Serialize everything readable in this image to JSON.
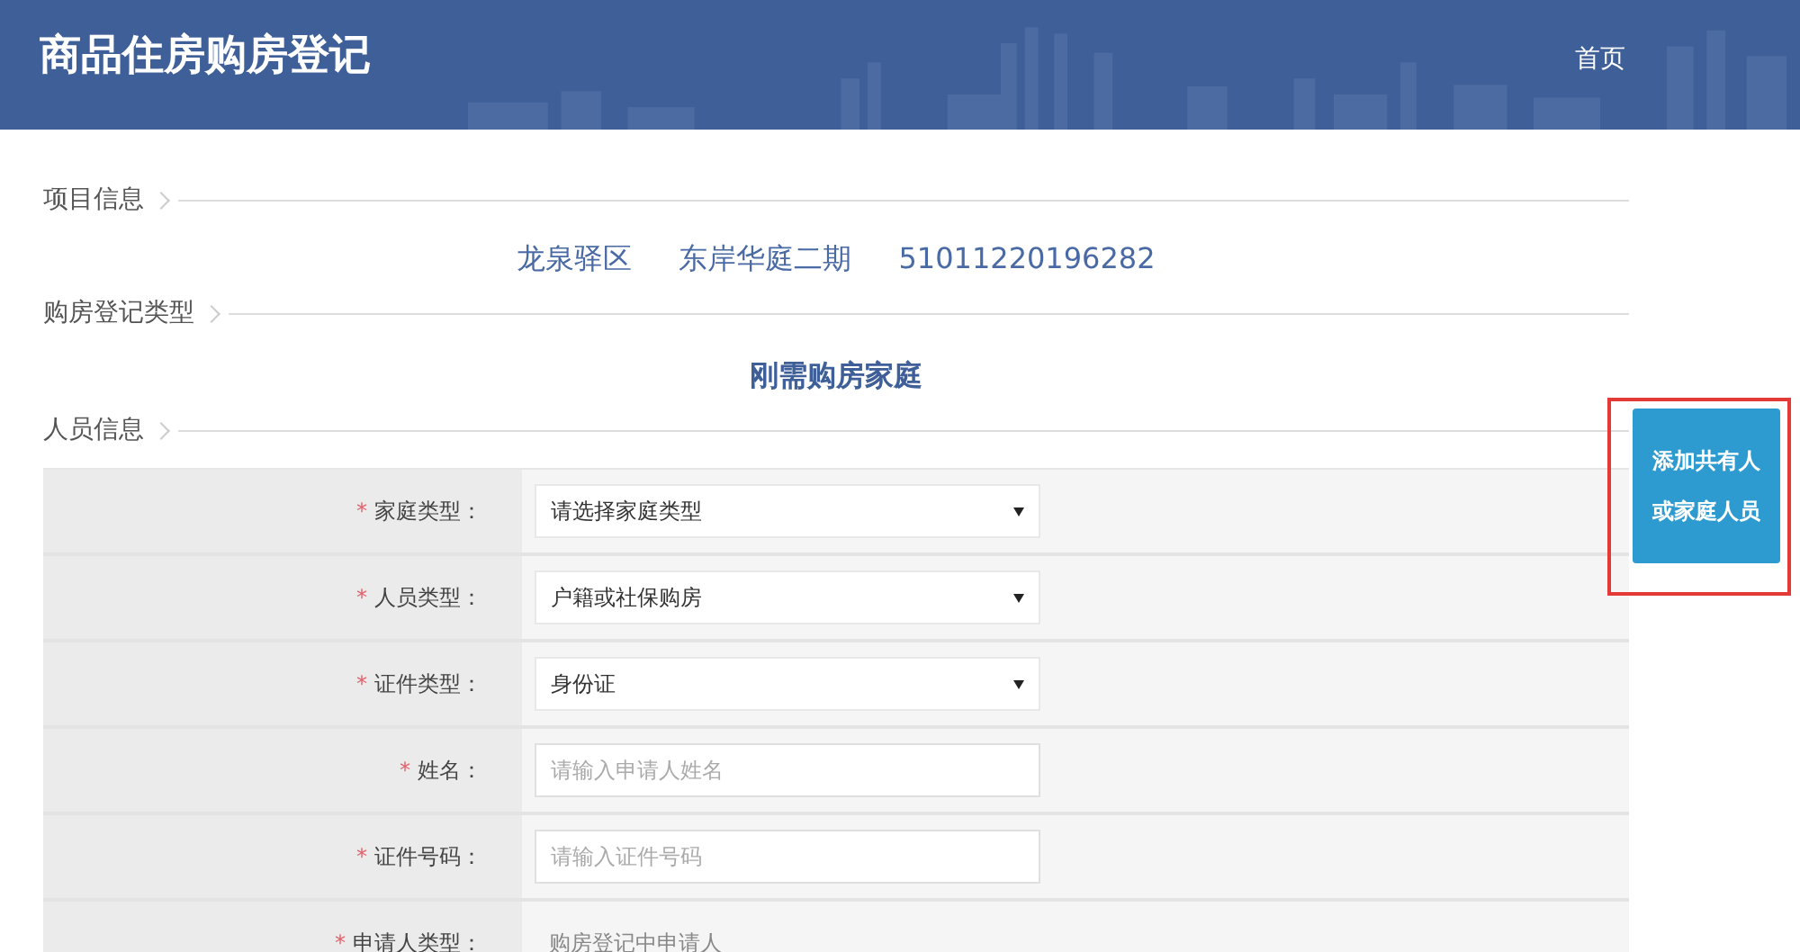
{
  "header": {
    "title": "商品住房购房登记",
    "nav": "首页"
  },
  "project_info": {
    "heading": "项目信息",
    "values": [
      "龙泉驿区",
      "东岸华庭二期",
      "51011220196282"
    ]
  },
  "registration_type": {
    "heading": "购房登记类型",
    "value": "刚需购房家庭"
  },
  "person_info": {
    "heading": "人员信息",
    "fields": [
      {
        "kind": "select",
        "marker": "*",
        "label": "家庭类型：",
        "value": "请选择家庭类型"
      },
      {
        "kind": "select",
        "marker": "*",
        "label": "人员类型：",
        "value": "户籍或社保购房"
      },
      {
        "kind": "select",
        "marker": "*",
        "label": "证件类型：",
        "value": "身份证"
      },
      {
        "kind": "input",
        "marker": "*",
        "label": "姓名：",
        "placeholder": "请输入申请人姓名"
      },
      {
        "kind": "input",
        "marker": "*",
        "label": "证件号码：",
        "placeholder": "请输入证件号码"
      },
      {
        "kind": "text",
        "marker": "*",
        "label": "申请人类型：",
        "value": "购房登记中申请人"
      }
    ]
  },
  "side_button": {
    "label": "添加共有人或家庭人员",
    "highlighted": true
  }
}
